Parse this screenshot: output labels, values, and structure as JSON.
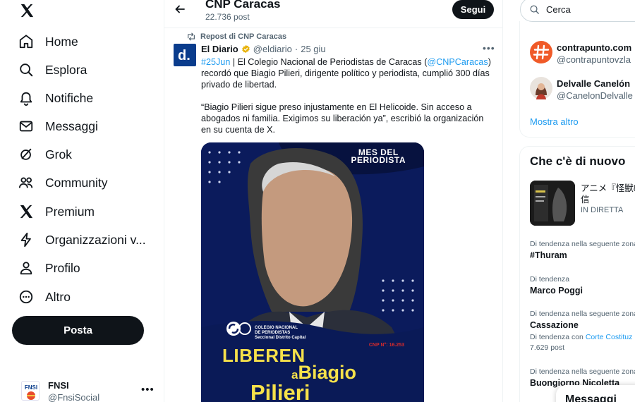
{
  "nav": {
    "items": [
      {
        "label": "Home",
        "icon": "home-icon"
      },
      {
        "label": "Esplora",
        "icon": "search-icon"
      },
      {
        "label": "Notifiche",
        "icon": "bell-icon"
      },
      {
        "label": "Messaggi",
        "icon": "envelope-icon"
      },
      {
        "label": "Grok",
        "icon": "grok-icon"
      },
      {
        "label": "Community",
        "icon": "people-icon"
      },
      {
        "label": "Premium",
        "icon": "x-logo-icon"
      },
      {
        "label": "Organizzazioni v...",
        "icon": "lightning-icon"
      },
      {
        "label": "Profilo",
        "icon": "person-icon"
      },
      {
        "label": "Altro",
        "icon": "more-circle-icon"
      }
    ],
    "post_label": "Posta",
    "account": {
      "name": "FNSI",
      "handle": "@FnsiSocial",
      "avatar_text": "FNSI"
    }
  },
  "header": {
    "title": "CNP Caracas",
    "post_count": "22.736 post",
    "follow_label": "Segui"
  },
  "tweet": {
    "repost_label": "Repost di CNP Caracas",
    "author_name": "El Diario",
    "author_handle": "@eldiario",
    "date": "25 giu",
    "avatar_letter": "d.",
    "text": {
      "hashtag": "#25Jun",
      "p1_a": " | El Colegio Nacional de Periodistas de Caracas (",
      "mention": "@CNPCaracas",
      "p1_b": ") recordó que Biagio Pilieri, dirigente político y periodista, cumplió 300 días privado de libertad.",
      "p2": "“Biagio Pilieri sigue preso injustamente en El Helicoide. Sin acceso a abogados ni familia. Exigimos su liberación ya”, escribió la organización en su cuenta de X."
    },
    "media": {
      "banner_line1": "MES DEL",
      "banner_line2": "PERIODISTA",
      "logo_text_1": "COLEGIO NACIONAL",
      "logo_text_2": "DE PERIODISTAS",
      "logo_text_3": "Seccional Distrito Capital",
      "cnp_number": "CNP N°: 16.253",
      "line1": "LIBEREN",
      "line2_small": "a",
      "line2": "Biagio",
      "line3": "Pilieri"
    }
  },
  "right": {
    "search_placeholder": "Cerca",
    "who_to_follow": [
      {
        "name": "contrapunto.com",
        "handle": "@contrapuntovzla"
      },
      {
        "name": "Delvalle Canelón",
        "handle": "@CanelonDelvalle"
      }
    ],
    "show_more": "Mostra altro",
    "whats_new_title": "Che c'è di nuovo",
    "live": {
      "title_line1": "アニメ『怪獣8",
      "title_line2": "信",
      "status": "IN DIRETTA"
    },
    "trends": [
      {
        "context": "Di tendenza nella seguente zona",
        "name": "#Thuram"
      },
      {
        "context": "Di tendenza",
        "name": "Marco Poggi"
      },
      {
        "context": "Di tendenza nella seguente zona",
        "name": "Cassazione",
        "sub_prefix": "Di tendenza con ",
        "sub_link": "Corte Costituz",
        "count": "7.629 post"
      },
      {
        "context": "Di tendenza nella seguente zona",
        "name": "Buongiorno Nicoletta"
      }
    ],
    "messages_label": "Messaggi"
  }
}
